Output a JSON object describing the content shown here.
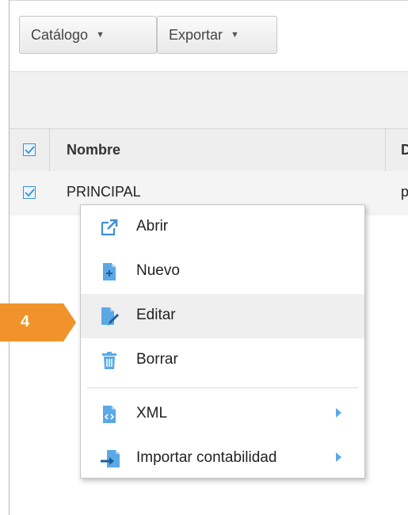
{
  "toolbar": {
    "catalogo_label": "Catálogo",
    "exportar_label": "Exportar"
  },
  "grid": {
    "columns": [
      "Nombre",
      "D"
    ],
    "rows": [
      {
        "nombre": "PRINCIPAL",
        "d": "p",
        "checked": true
      }
    ]
  },
  "context_menu": {
    "items": [
      {
        "label": "Abrir",
        "icon": "open-external-icon"
      },
      {
        "label": "Nuevo",
        "icon": "new-document-icon"
      },
      {
        "label": "Editar",
        "icon": "edit-document-icon",
        "highlighted": true
      },
      {
        "label": "Borrar",
        "icon": "trash-icon"
      },
      {
        "label": "XML",
        "icon": "xml-file-icon",
        "has_submenu": true
      },
      {
        "label": "Importar contabilidad",
        "icon": "import-icon",
        "has_submenu": true
      }
    ]
  },
  "step_badge": {
    "number": "4"
  },
  "colors": {
    "accent_blue": "#3d8fd6",
    "badge_orange": "#f0932b",
    "menu_hover": "#efefef"
  }
}
